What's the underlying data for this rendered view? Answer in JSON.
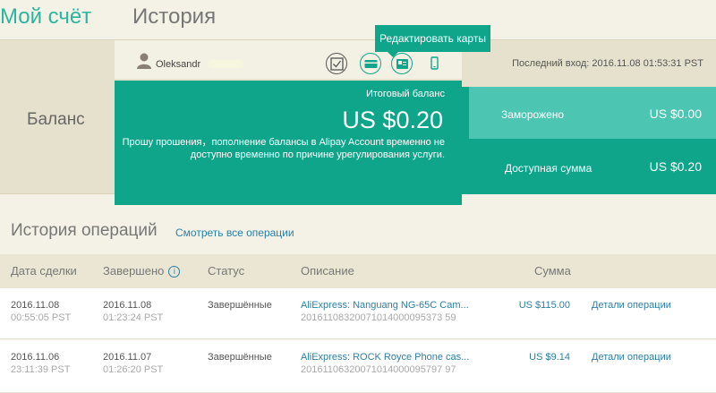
{
  "tabs": {
    "my_account": "Мой счёт",
    "history": "История"
  },
  "user": {
    "name": "Oleksandr"
  },
  "tooltip": "Редактировать карты",
  "balance": {
    "label": "Баланс",
    "total_title": "Итоговый баланс",
    "total_amount": "US $0.20",
    "note": "Прошу прошения，пополнение балансы в Alipay Account временно не доступно временно по причине урегулирования услуги.",
    "last_login": "Последний вход: 2016.11.08 01:53:31 PST",
    "frozen_label": "Заморожено",
    "frozen_amount": "US $0.00",
    "available_label": "Доступная сумма",
    "available_amount": "US $0.20"
  },
  "history": {
    "title": "История операций",
    "view_all": "Смотреть все операции",
    "columns": [
      "Дата сделки",
      "Завершено",
      "Статус",
      "Описание",
      "Сумма"
    ],
    "rows": [
      {
        "date": "2016.11.08",
        "date_time": "00:55:05 PST",
        "completed": "2016.11.08",
        "completed_time": "01:23:24 PST",
        "status": "Завершённые",
        "desc": "AliExpress: Nanguang NG-65C Cam...",
        "desc_id": "20161108320071014000095373 59",
        "amount": "US $115.00",
        "details": "Детали операции"
      },
      {
        "date": "2016.11.06",
        "date_time": "23:11:39 PST",
        "completed": "2016.11.07",
        "completed_time": "01:26:20 PST",
        "status": "Завершённые",
        "desc": "AliExpress: ROCK Royce Phone cas...",
        "desc_id": "20161106320071014000095797 97",
        "amount": "US $9.14",
        "details": "Детали операции"
      }
    ]
  }
}
